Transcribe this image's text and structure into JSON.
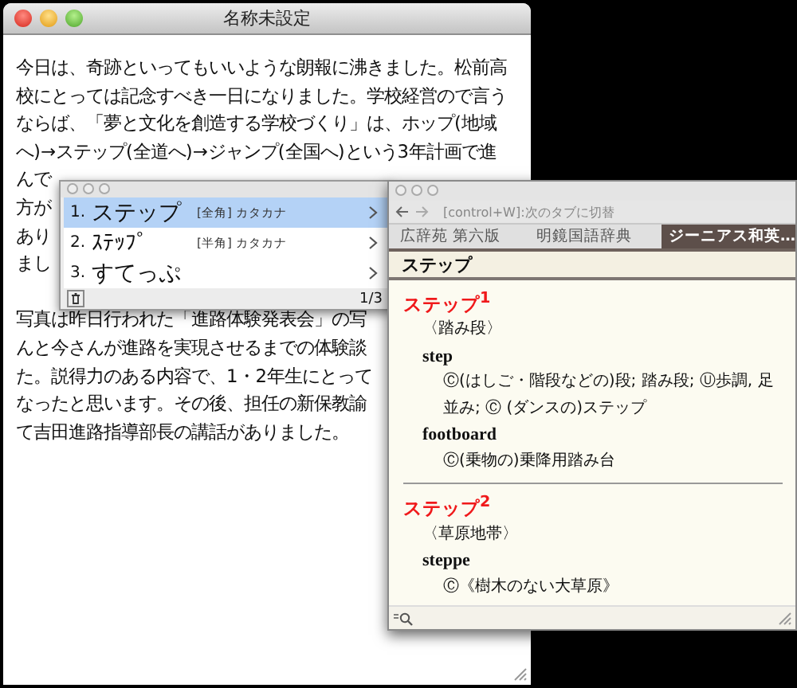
{
  "editor": {
    "title": "名称未設定",
    "paragraphs": [
      {
        "lines": [
          "今日は、奇跡といってもいいような朗報に沸きました。松前高",
          "校にとっては記念すべき一日になりました。学校経営ので言う",
          "ならば、「夢と文化を創造する学校づくり」は、ホップ(地域",
          "へ)→ステップ(全道へ)→ジャンプ(全国へ)という3年計画で進",
          "んで",
          "方が",
          "あり",
          "まし"
        ]
      },
      {
        "lines": [
          "写真は昨日行われた「進路体験発表会」の写",
          "んと今さんが進路を実現させるまでの体験談",
          "た。説得力のある内容で、1・2年生にとって",
          "なったと思います。その後、担任の新保教諭",
          "て吉田進路指導部長の講話がありました。"
        ]
      }
    ]
  },
  "candidates": {
    "items": [
      {
        "number": "1.",
        "text": "ステップ",
        "note": "[全角] カタカナ",
        "selected": true
      },
      {
        "number": "2.",
        "text": "ｽﾃｯﾌﾟ",
        "note": "[半角] カタカナ",
        "selected": false
      },
      {
        "number": "3.",
        "text": "すてっぷ",
        "selected": false
      }
    ],
    "page": "1/3"
  },
  "dictionary": {
    "hint": "[control+W]:次のタブに切替",
    "tabs": [
      {
        "label": "広辞苑 第六版",
        "selected": false
      },
      {
        "label": "明鏡国語辞典",
        "selected": false
      },
      {
        "label": "ジーニアス和英…",
        "selected": true
      }
    ],
    "query": "ステップ",
    "entries": [
      {
        "headword": "ステップ$^{1}$",
        "gloss": "〈踏み段〉",
        "senses": [
          {
            "word": "step",
            "definition": "Ⓒ(はしご・階段などの)段; 踏み段; Ⓤ歩調, 足並み; Ⓒ (ダンスの)ステップ"
          },
          {
            "word": "footboard",
            "definition": "Ⓒ(乗物の)乗降用踏み台"
          }
        ]
      },
      {
        "headword": "ステップ$^{2}$",
        "gloss": "〈草原地帯〉",
        "senses": [
          {
            "word": "steppe",
            "definition": "Ⓒ《樹木のない大草原》"
          }
        ]
      }
    ]
  }
}
